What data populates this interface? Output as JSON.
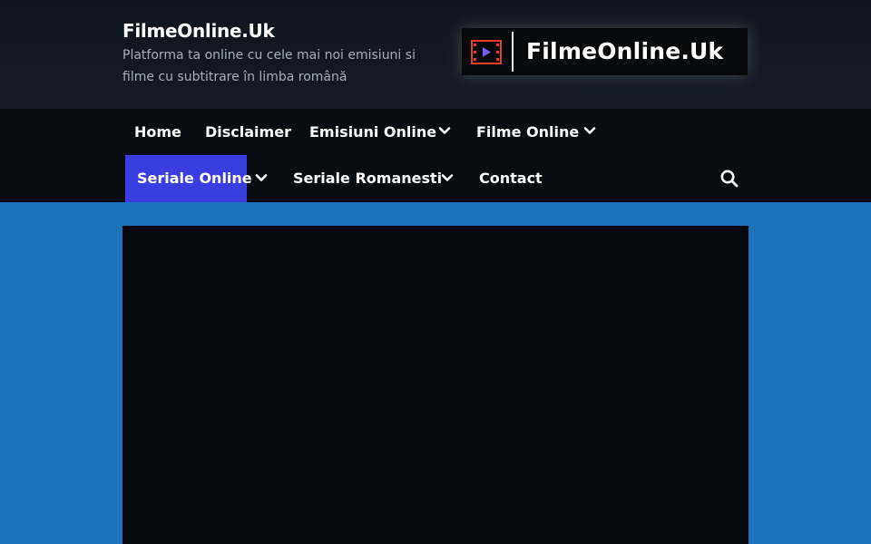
{
  "header": {
    "site_title": "FilmeOnline.Uk",
    "tagline": "Platforma ta online cu cele mai noi emisiuni si filme cu subtitrare în limba română",
    "logo_text": "FilmeOnline.Uk"
  },
  "nav": {
    "items": [
      {
        "label": "Home"
      },
      {
        "label": "Disclaimer"
      },
      {
        "label": "Emisiuni Online"
      },
      {
        "label": "Filme Online"
      },
      {
        "label": "Seriale Online"
      },
      {
        "label": "Seriale Romanesti"
      },
      {
        "label": "Contact"
      }
    ],
    "search_icon": "search-icon",
    "dropdown_icon": "chevron-down-icon"
  },
  "colors": {
    "page_background": "#1e72bd",
    "header_background": "#121922",
    "nav_background": "#070b12",
    "active_nav": "#3b3de0",
    "content_background": "#040910"
  }
}
